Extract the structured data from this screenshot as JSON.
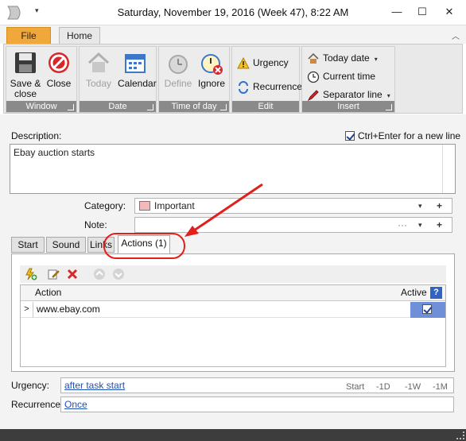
{
  "window": {
    "title": "Saturday, November 19, 2016 (Week 47), 8:22 AM",
    "qat_arrow": "▾",
    "minimize": "—",
    "maximize": "☐",
    "close": "✕"
  },
  "ribbon": {
    "tabs": {
      "file": "File",
      "home": "Home"
    },
    "groups": {
      "window": {
        "label": "Window",
        "save_close": [
          "Save &",
          "close"
        ],
        "close": "Close"
      },
      "date": {
        "label": "Date",
        "today": "Today",
        "calendar": "Calendar"
      },
      "time_of_day": {
        "label": "Time of day",
        "define": "Define",
        "ignore": "Ignore"
      },
      "edit": {
        "label": "Edit",
        "urgency": "Urgency",
        "recurrence": "Recurrence"
      },
      "insert": {
        "label": "Insert",
        "today_date": "Today date",
        "current_time": "Current time",
        "separator_line": "Separator line"
      }
    }
  },
  "form": {
    "description_label": "Description:",
    "new_line_option": "Ctrl+Enter for a new line",
    "new_line_checked": true,
    "description_value": "Ebay auction starts",
    "category_label": "Category:",
    "category_value": "Important",
    "category_color": "#f5b7b7",
    "note_label": "Note:",
    "note_value": "",
    "ellipsis": "···",
    "plus": "+",
    "dropdown": "▾"
  },
  "tabs": [
    "Start",
    "Sound",
    "Links",
    "Actions (1)"
  ],
  "actions_grid": {
    "columns": [
      "Action",
      "Active"
    ],
    "help": "?",
    "rows": [
      {
        "action": "www.ebay.com",
        "active": true
      }
    ]
  },
  "urgency": {
    "label": "Urgency:",
    "value": "after task start",
    "shortcuts": [
      "Start",
      "-1D",
      "-1W",
      "-1M"
    ]
  },
  "recurrence": {
    "label": "Recurrence:",
    "value": "Once"
  },
  "colors": {
    "accent_file_tab": "#f0a83a",
    "group_label_bg": "#8a8a8a",
    "callout_red": "#e0201c"
  }
}
